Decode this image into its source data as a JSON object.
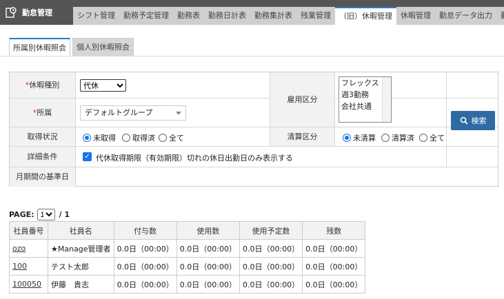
{
  "app": {
    "title": "勤怠管理"
  },
  "nav": {
    "tabs": [
      "シフト管理",
      "勤務予定管理",
      "勤務表",
      "勤務日計表",
      "勤務集計表",
      "残業管理",
      "（旧）休暇管理",
      "休暇管理",
      "勤怠データ出力",
      "勤怠"
    ],
    "active_index": 6
  },
  "subtabs": {
    "items": [
      "所属別休暇照会",
      "個人別休暇照会"
    ],
    "active_index": 0
  },
  "form": {
    "leave_type": {
      "required_mark": "*",
      "label": "休暇種別",
      "value": "代休"
    },
    "affiliation": {
      "required_mark": "*",
      "label": "所属",
      "value": "デフォルトグループ"
    },
    "employment": {
      "label": "雇用区分",
      "options": [
        "フレックス",
        "週3勤務",
        "会社共通"
      ]
    },
    "acquisition": {
      "label": "取得状況",
      "options": [
        "未取得",
        "取得済",
        "全て"
      ],
      "selected": 0
    },
    "settlement": {
      "label": "清算区分",
      "options": [
        "未清算",
        "清算済",
        "全て"
      ],
      "selected": 0
    },
    "details": {
      "label": "詳細条件",
      "checkbox_label": "代休取得期限（有効期限）切れの休日出勤日のみ表示する",
      "checked": true
    },
    "base_date": {
      "label": "月期間の基準日"
    },
    "search_button": "検索"
  },
  "pager": {
    "label": "PAGE:",
    "current": "1",
    "total": "/ 1"
  },
  "table": {
    "headers": [
      "社員番号",
      "社員名",
      "付与数",
      "使用数",
      "使用予定数",
      "残数"
    ],
    "rows": [
      {
        "id": "ozo",
        "name": "★Manage管理者",
        "granted": "0.0日（00:00）",
        "used": "0.0日（00:00）",
        "planned": "0.0日（00:00）",
        "remaining": "0.0日（00:00）"
      },
      {
        "id": "100",
        "name": "テスト太郎",
        "granted": "0.0日（00:00）",
        "used": "0.0日（00:00）",
        "planned": "0.0日（00:00）",
        "remaining": "0.0日（00:00）"
      },
      {
        "id": "100050",
        "name": "伊藤　貴志",
        "granted": "0.0日（00:00）",
        "used": "0.0日（00:00）",
        "planned": "0.0日（00:00）",
        "remaining": "0.0日（00:00）"
      }
    ]
  },
  "colors": {
    "topbar": "#555555",
    "accent": "#2a7ac4",
    "button": "#2f6aa5",
    "checkbox": "#1a73e8",
    "required": "#dd3333"
  }
}
